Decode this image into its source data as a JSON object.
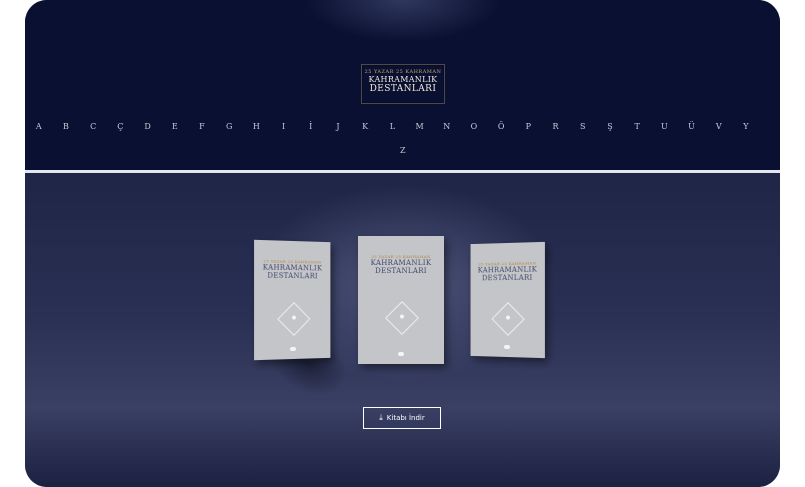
{
  "logo": {
    "top_line": "25 YAZAR 25 KAHRAMAN",
    "title_line1": "KAHRAMANLIK",
    "title_line2": "DESTANLARI"
  },
  "alphabet": {
    "row1": [
      "A",
      "B",
      "C",
      "Ç",
      "D",
      "E",
      "F",
      "G",
      "H",
      "I",
      "İ",
      "J",
      "K",
      "L",
      "M",
      "N",
      "O",
      "Ö",
      "P",
      "R",
      "S",
      "Ş",
      "T",
      "U",
      "Ü",
      "V",
      "Y"
    ],
    "row2": [
      "Z"
    ]
  },
  "books": [
    {
      "top_line": "25 YAZAR 25 KAHRAMAN",
      "title_line1": "KAHRAMANLIK",
      "title_line2": "DESTANLARI"
    },
    {
      "top_line": "25 YAZAR 25 KAHRAMAN",
      "title_line1": "KAHRAMANLIK",
      "title_line2": "DESTANLARI"
    },
    {
      "top_line": "25 YAZAR 25 KAHRAMAN",
      "title_line1": "KAHRAMANLIK",
      "title_line2": "DESTANLARI"
    }
  ],
  "download": {
    "label": "Kitabı İndir",
    "icon": "download-icon"
  },
  "colors": {
    "header_bg": "#0a1031",
    "divider": "#e6e7ee",
    "book_cover": "#c3c5c8",
    "gold_accent": "#c8a96a"
  }
}
